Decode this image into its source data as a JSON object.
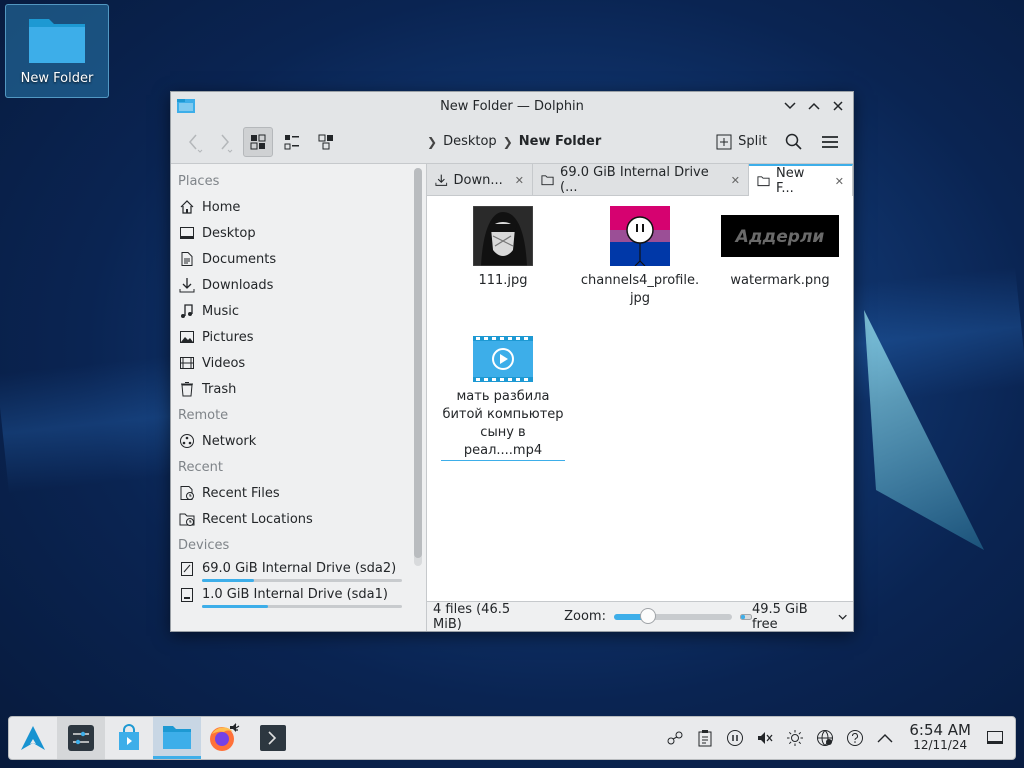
{
  "desktop": {
    "icon_label": "New Folder"
  },
  "window": {
    "title": "New Folder — Dolphin"
  },
  "toolbar": {
    "breadcrumb": [
      "Desktop",
      "New Folder"
    ],
    "split_label": "Split"
  },
  "sidebar": {
    "places_heading": "Places",
    "places": [
      {
        "label": "Home",
        "icon": "home-icon"
      },
      {
        "label": "Desktop",
        "icon": "desktop-icon"
      },
      {
        "label": "Documents",
        "icon": "documents-icon"
      },
      {
        "label": "Downloads",
        "icon": "downloads-icon"
      },
      {
        "label": "Music",
        "icon": "music-icon"
      },
      {
        "label": "Pictures",
        "icon": "pictures-icon"
      },
      {
        "label": "Videos",
        "icon": "videos-icon"
      },
      {
        "label": "Trash",
        "icon": "trash-icon"
      }
    ],
    "remote_heading": "Remote",
    "remote": [
      {
        "label": "Network",
        "icon": "network-icon"
      }
    ],
    "recent_heading": "Recent",
    "recent": [
      {
        "label": "Recent Files",
        "icon": "recent-files-icon"
      },
      {
        "label": "Recent Locations",
        "icon": "recent-locations-icon"
      }
    ],
    "devices_heading": "Devices",
    "devices": [
      {
        "label": "69.0 GiB Internal Drive (sda2)",
        "usage_fraction": 0.26
      },
      {
        "label": "1.0 GiB Internal Drive (sda1)",
        "usage_fraction": 0.33
      }
    ]
  },
  "tabs": [
    {
      "label": "Down...",
      "icon": "download-icon",
      "active": false
    },
    {
      "label": "69.0 GiB Internal Drive (...",
      "icon": "folder-icon",
      "active": false
    },
    {
      "label": "New F...",
      "icon": "folder-icon",
      "active": true
    }
  ],
  "files": [
    {
      "name": "111.jpg",
      "kind": "image-dark"
    },
    {
      "name": "channels4_profile.\njpg",
      "kind": "image-flag"
    },
    {
      "name": "watermark.png",
      "kind": "image-watermark",
      "watermark_text": "Аддерли"
    },
    {
      "name": "мать разбила\nбитой компьютер\nсыну в реал....mp4",
      "kind": "video"
    }
  ],
  "statusbar": {
    "summary": "4 files (46.5 MiB)",
    "zoom_label": "Zoom:",
    "zoom_fraction": 0.28,
    "free_space": "49.5 GiB free"
  },
  "taskbar": {
    "clock_time": "6:54 AM",
    "clock_date": "12/11/24"
  },
  "colors": {
    "accent": "#3daee9",
    "folder": "#3daee9"
  }
}
